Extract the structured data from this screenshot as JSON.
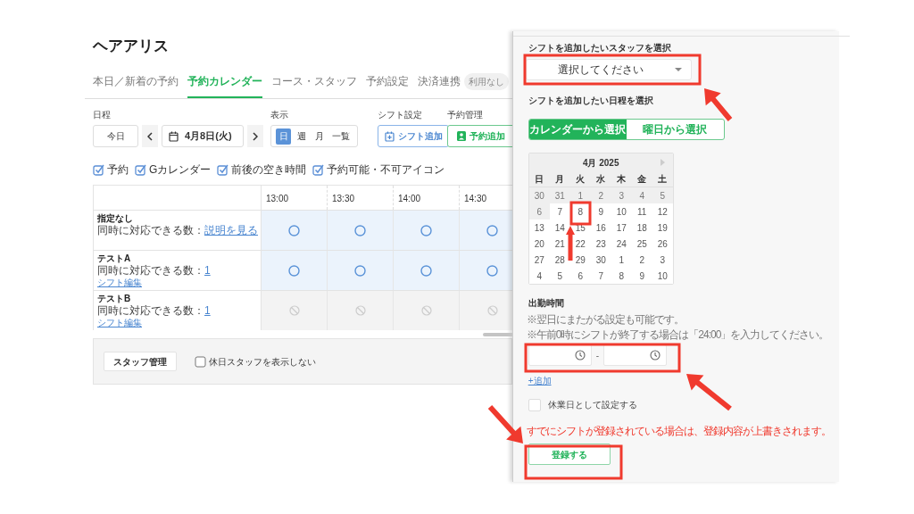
{
  "app_title": "ヘアアリス",
  "tabs": [
    {
      "label": "本日／新着の予約",
      "selected": false
    },
    {
      "label": "予約カレンダー",
      "selected": true
    },
    {
      "label": "コース・スタッフ",
      "selected": false
    },
    {
      "label": "予約設定",
      "selected": false
    },
    {
      "label": "決済連携",
      "selected": false,
      "badge": "利用なし"
    }
  ],
  "toolbar": {
    "schedule_label": "日程",
    "today_button": "今日",
    "date": "4月8日(火)",
    "view_label": "表示",
    "views": [
      {
        "label": "日",
        "selected": true
      },
      {
        "label": "週",
        "selected": false
      },
      {
        "label": "月",
        "selected": false
      },
      {
        "label": "一覧",
        "selected": false
      }
    ],
    "shift_label": "シフト設定",
    "shift_button": "シフト追加",
    "booking_label": "予約管理",
    "booking_button": "予約追加"
  },
  "filters": [
    {
      "label": "予約",
      "checked": true
    },
    {
      "label": "Gカレンダー",
      "checked": true
    },
    {
      "label": "前後の空き時間",
      "checked": true
    },
    {
      "label": "予約可能・不可アイコン",
      "checked": true
    }
  ],
  "table": {
    "columns": [
      "13:00",
      "13:30",
      "14:00",
      "14:30"
    ],
    "rows": [
      {
        "name": "指定なし",
        "capacity_label": "同時に対応できる数：",
        "capacity_value": "説明を見る",
        "available": true
      },
      {
        "name": "テストA",
        "capacity_label": "同時に対応できる数：",
        "capacity_value": "1",
        "shift_edit": "シフト編集",
        "available": true
      },
      {
        "name": "テストB",
        "capacity_label": "同時に対応できる数：",
        "capacity_value": "1",
        "shift_edit": "シフト編集",
        "available": false
      }
    ]
  },
  "footer": {
    "staff_button": "スタッフ管理",
    "hide_holiday_staff": {
      "label": "休日スタッフを表示しない",
      "checked": false
    }
  },
  "panel": {
    "staff_heading": "シフトを追加したいスタッフを選択",
    "staff_select": {
      "placeholder": "選択してください"
    },
    "date_heading": "シフトを追加したい日程を選択",
    "modes": [
      {
        "label": "カレンダーから選択",
        "selected": true
      },
      {
        "label": "曜日から選択",
        "selected": false
      }
    ],
    "calendar": {
      "month": "4月 2025",
      "weekdays": [
        "日",
        "月",
        "火",
        "水",
        "木",
        "金",
        "土"
      ],
      "days": [
        {
          "label": "30",
          "disabled": true
        },
        {
          "label": "31",
          "disabled": true
        },
        {
          "label": "1",
          "disabled": true
        },
        {
          "label": "2",
          "disabled": true
        },
        {
          "label": "3",
          "disabled": true
        },
        {
          "label": "4",
          "disabled": true
        },
        {
          "label": "5",
          "disabled": true
        },
        {
          "label": "6",
          "disabled": true
        },
        {
          "label": "7",
          "disabled": false
        },
        {
          "label": "8",
          "disabled": false
        },
        {
          "label": "9",
          "disabled": false
        },
        {
          "label": "10",
          "disabled": false
        },
        {
          "label": "11",
          "disabled": false
        },
        {
          "label": "12",
          "disabled": false
        },
        {
          "label": "13",
          "disabled": false
        },
        {
          "label": "14",
          "disabled": false
        },
        {
          "label": "15",
          "disabled": false
        },
        {
          "label": "16",
          "disabled": false
        },
        {
          "label": "17",
          "disabled": false
        },
        {
          "label": "18",
          "disabled": false
        },
        {
          "label": "19",
          "disabled": false
        },
        {
          "label": "20",
          "disabled": false
        },
        {
          "label": "21",
          "disabled": false
        },
        {
          "label": "22",
          "disabled": false
        },
        {
          "label": "23",
          "disabled": false
        },
        {
          "label": "24",
          "disabled": false
        },
        {
          "label": "25",
          "disabled": false
        },
        {
          "label": "26",
          "disabled": false
        },
        {
          "label": "27",
          "disabled": false
        },
        {
          "label": "28",
          "disabled": false
        },
        {
          "label": "29",
          "disabled": false
        },
        {
          "label": "30",
          "disabled": false
        },
        {
          "label": "1",
          "disabled": false
        },
        {
          "label": "2",
          "disabled": false
        },
        {
          "label": "3",
          "disabled": false
        },
        {
          "label": "4",
          "disabled": false
        },
        {
          "label": "5",
          "disabled": false
        },
        {
          "label": "6",
          "disabled": false
        },
        {
          "label": "7",
          "disabled": false
        },
        {
          "label": "8",
          "disabled": false
        },
        {
          "label": "9",
          "disabled": false
        },
        {
          "label": "10",
          "disabled": false
        }
      ]
    },
    "time_heading": "出勤時間",
    "notes": [
      "※翌日にまたがる設定も可能です。",
      "※午前0時にシフトが終了する場合は「24:00」を入力してください。"
    ],
    "time_separator": "-",
    "add_link": "+追加",
    "holiday": {
      "label": "休業日として設定する",
      "checked": false
    },
    "warning": "すでにシフトが登録されている場合は、登録内容が上書きされます。",
    "submit_button": "登録する"
  }
}
